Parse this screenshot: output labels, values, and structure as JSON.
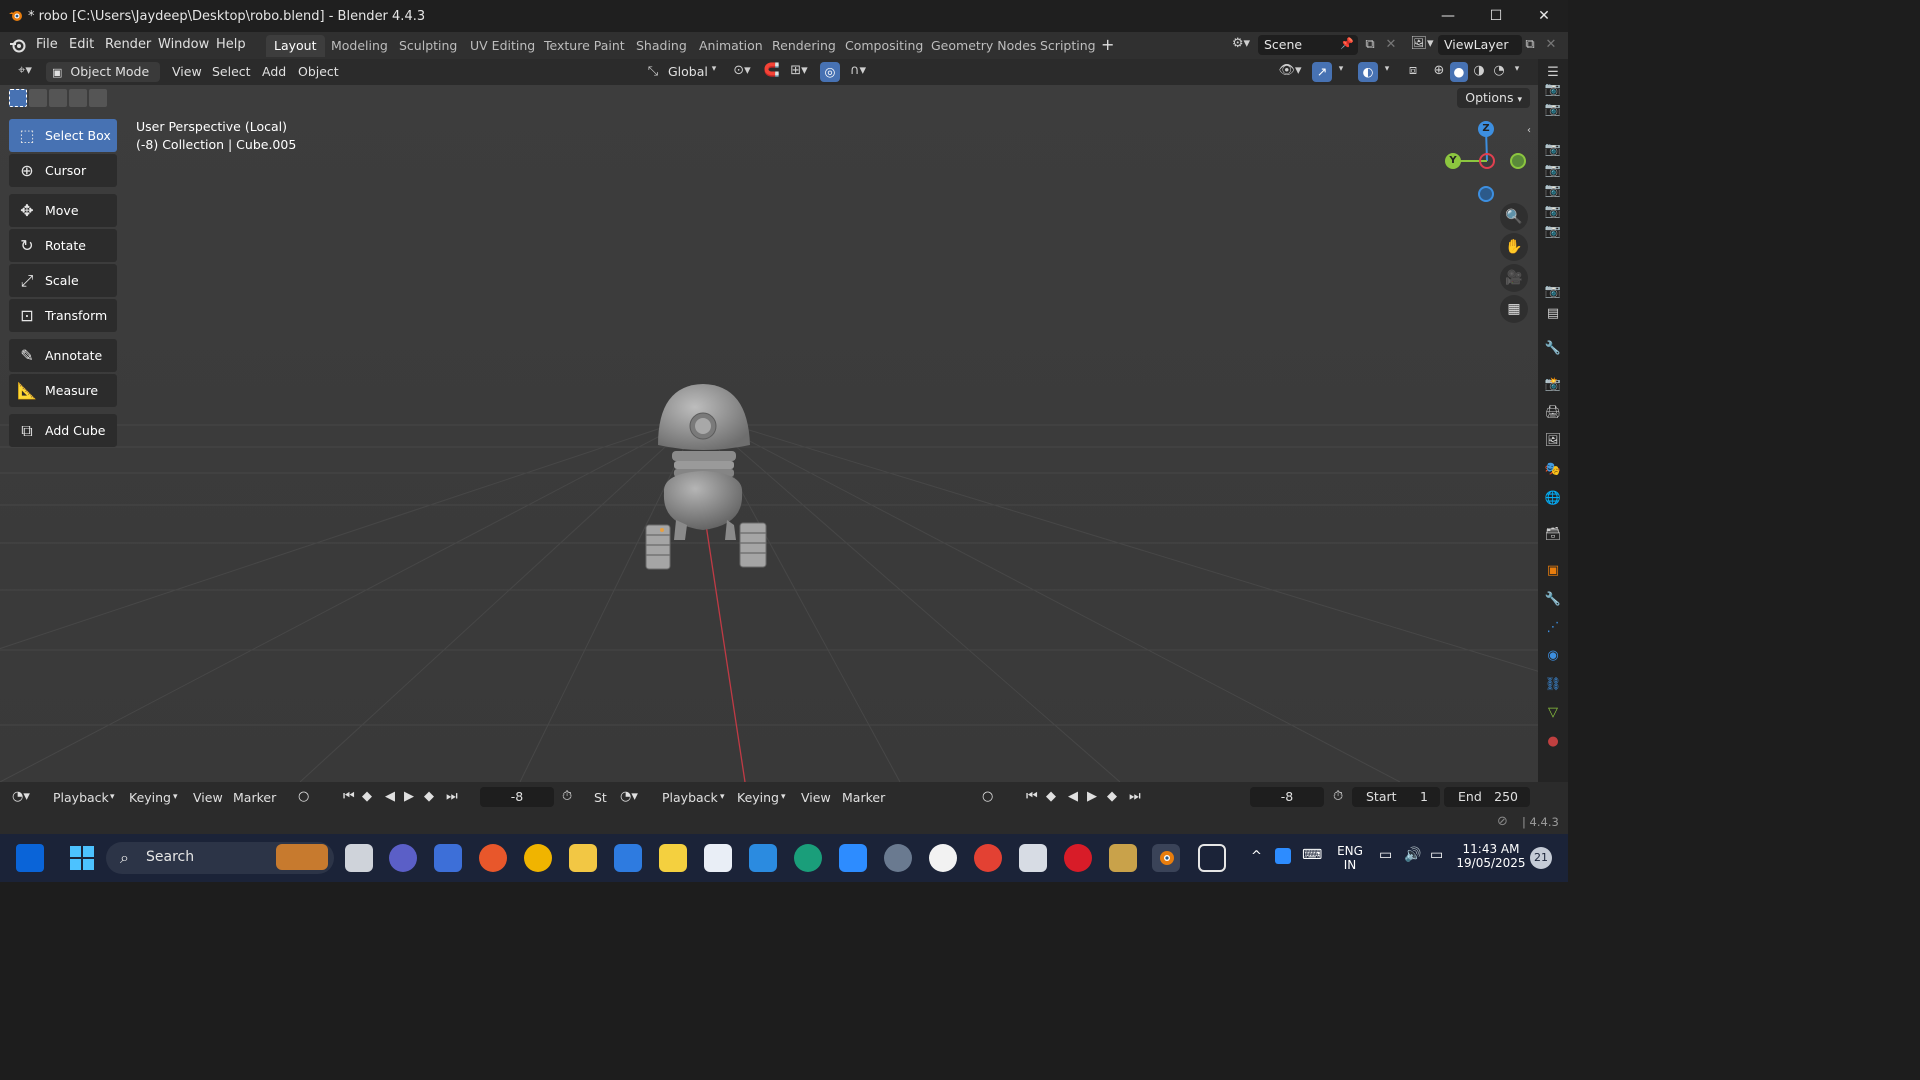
{
  "window": {
    "title": "* robo [C:\\Users\\Jaydeep\\Desktop\\robo.blend] - Blender 4.4.3",
    "controls": {
      "minimize": "—",
      "maximize": "☐",
      "close": "✕"
    }
  },
  "menubar": {
    "items": [
      "File",
      "Edit",
      "Render",
      "Window",
      "Help"
    ],
    "workspaces": [
      "Layout",
      "Modeling",
      "Sculpting",
      "UV Editing",
      "Texture Paint",
      "Shading",
      "Animation",
      "Rendering",
      "Compositing",
      "Geometry Nodes",
      "Scripting"
    ],
    "active_workspace": "Layout",
    "add_tab": "+",
    "scene": "Scene",
    "view_layer": "ViewLayer"
  },
  "viewport_header": {
    "mode": "Object Mode",
    "menus": [
      "View",
      "Select",
      "Add",
      "Object"
    ],
    "orientation": "Global",
    "options": "Options"
  },
  "viewport": {
    "perspective": "User Perspective (Local)",
    "collection": "(-8) Collection | Cube.005"
  },
  "toolbar": {
    "tools": [
      {
        "label": "Select Box",
        "icon": "select-box-icon",
        "active": true
      },
      {
        "label": "Cursor",
        "icon": "cursor-icon"
      },
      {
        "label": "Move",
        "icon": "move-icon"
      },
      {
        "label": "Rotate",
        "icon": "rotate-icon"
      },
      {
        "label": "Scale",
        "icon": "scale-icon"
      },
      {
        "label": "Transform",
        "icon": "transform-icon"
      },
      {
        "label": "Annotate",
        "icon": "annotate-icon"
      },
      {
        "label": "Measure",
        "icon": "measure-icon"
      },
      {
        "label": "Add Cube",
        "icon": "add-cube-icon"
      }
    ]
  },
  "gizmo": {
    "z": "Z",
    "y": "Y"
  },
  "timeline": {
    "left": {
      "playback": "Playback",
      "keying": "Keying",
      "view": "View",
      "marker": "Marker",
      "frame": "-8",
      "start_trunc": "St"
    },
    "right": {
      "playback": "Playback",
      "keying": "Keying",
      "view": "View",
      "marker": "Marker",
      "frame": "-8",
      "start_label": "Start",
      "start": "1",
      "end_label": "End",
      "end": "250"
    }
  },
  "statusbar": {
    "version": "4.4.3"
  },
  "taskbar": {
    "search": "Search",
    "lang_top": "ENG",
    "lang_bottom": "IN",
    "time": "11:43 AM",
    "date": "19/05/2025",
    "notifications": "21"
  },
  "colors": {
    "accent": "#4772b3",
    "x_axis": "#e04050",
    "y_axis": "#8cc63f",
    "z_axis": "#3d8fe0"
  }
}
